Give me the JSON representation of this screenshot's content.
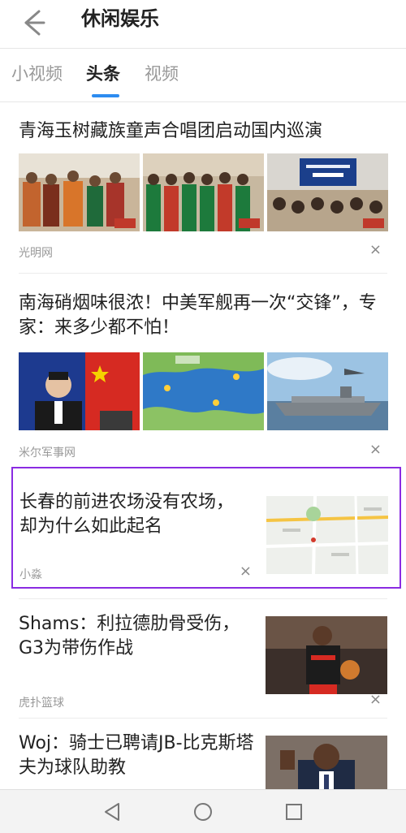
{
  "topbar": {
    "title": "休闲娱乐",
    "back_icon": "arrow-left-icon"
  },
  "tabs": [
    {
      "label": "小视频",
      "active": false
    },
    {
      "label": "头条",
      "active": true
    },
    {
      "label": "视频",
      "active": false
    }
  ],
  "feed": [
    {
      "headline": "青海玉树藏族童声合唱团启动国内巡演",
      "source": "光明网",
      "layout": "three-images"
    },
    {
      "headline": "南海硝烟味很浓！中美军舰再一次“交锋”，专家：来多少都不怕！",
      "source": "米尔军事网",
      "layout": "three-images"
    },
    {
      "headline": "长春的前进农场没有农场，却为什么如此起名",
      "source": "小淼",
      "layout": "side-image",
      "highlighted": true
    },
    {
      "headline": "Shams：利拉德肋骨受伤，G3为带伤作战",
      "source": "虎扑篮球",
      "layout": "side-image"
    },
    {
      "headline": "Woj：骑士已聘请JB-比克斯塔夫为球队助教",
      "layout": "side-image"
    }
  ],
  "close_glyph": "×",
  "navbar": {
    "back": "triangle-back-icon",
    "home": "circle-home-icon",
    "recent": "square-recent-icon"
  },
  "colors": {
    "accent": "#2d8cf0",
    "highlight_border": "#8a2be2"
  }
}
